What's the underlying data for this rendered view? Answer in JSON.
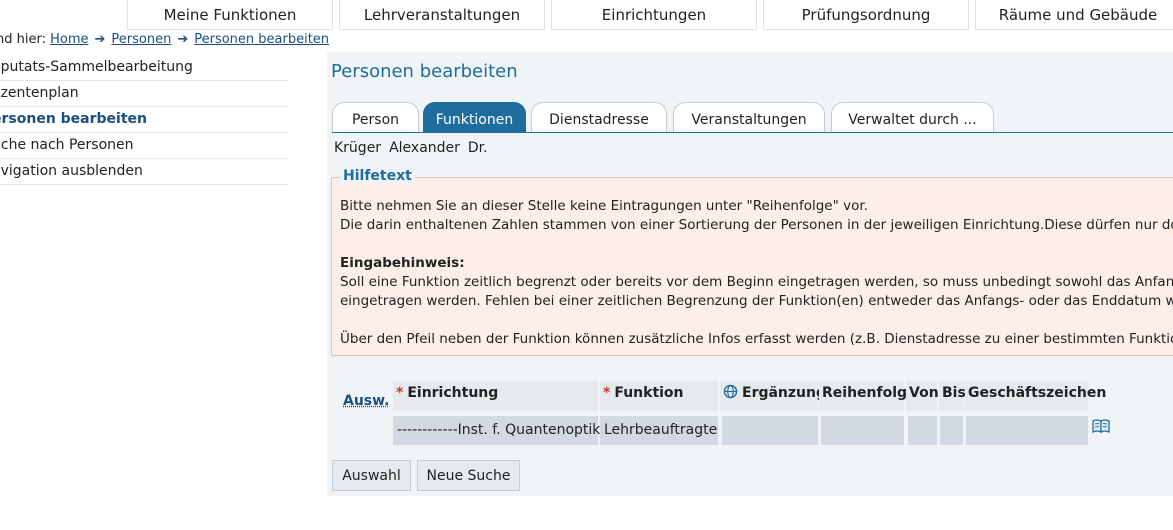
{
  "topnav": [
    "Meine Funktionen",
    "Lehrveranstaltungen",
    "Einrichtungen",
    "Prüfungsordnung",
    "Räume und Gebäude"
  ],
  "breadcrumb": {
    "prefix": "nd hier:",
    "items": [
      "Home",
      "Personen",
      "Personen bearbeiten"
    ]
  },
  "sidebar": [
    {
      "label": "eputats-Sammelbearbeitung",
      "active": false
    },
    {
      "label": "ozentenplan",
      "active": false
    },
    {
      "label": "ersonen bearbeiten",
      "active": true
    },
    {
      "label": "uche nach Personen",
      "active": false
    },
    {
      "label": "avigation ausblenden",
      "active": false
    }
  ],
  "page_title": "Personen bearbeiten",
  "tabs": [
    {
      "label": "Person",
      "active": false
    },
    {
      "label": "Funktionen",
      "active": true
    },
    {
      "label": "Dienstadresse",
      "active": false
    },
    {
      "label": "Veranstaltungen",
      "active": false
    },
    {
      "label": "Verwaltet durch ...",
      "active": false
    }
  ],
  "person": {
    "last": "Krüger",
    "first": "Alexander",
    "title": "Dr."
  },
  "help": {
    "legend": "Hilfetext",
    "line1": "Bitte nehmen Sie an dieser Stelle keine Eintragungen unter \"Reihenfolge\" vor.",
    "line2": "Die darin enthaltenen Zahlen stammen von einer Sortierung der Personen in der jeweiligen Einrichtung.Diese dürfen nur do",
    "heading": "Eingabehinweis:",
    "line3": "Soll eine Funktion zeitlich begrenzt oder bereits vor dem Beginn eingetragen werden, so muss unbedingt sowohl das Anfang",
    "line4": "eingetragen werden. Fehlen bei einer zeitlichen Begrenzung der Funktion(en) entweder das Anfangs- oder das Enddatum w",
    "line5": "Über den Pfeil neben der Funktion können zusätzliche Infos erfasst werden (z.B. Dienstadresse zu einer bestimmten Funktio"
  },
  "table": {
    "ausw": "Ausw.",
    "headers": [
      "Einrichtung",
      "Funktion",
      "Ergänzung",
      "Reihenfolge",
      "Von",
      "Bis",
      "Geschäftszeichen"
    ],
    "row": [
      "------------Inst. f. Quantenoptik",
      "Lehrbeauftragte",
      "",
      "",
      "",
      "",
      ""
    ]
  },
  "buttons": {
    "auswahl": "Auswahl",
    "neue_suche": "Neue Suche"
  }
}
